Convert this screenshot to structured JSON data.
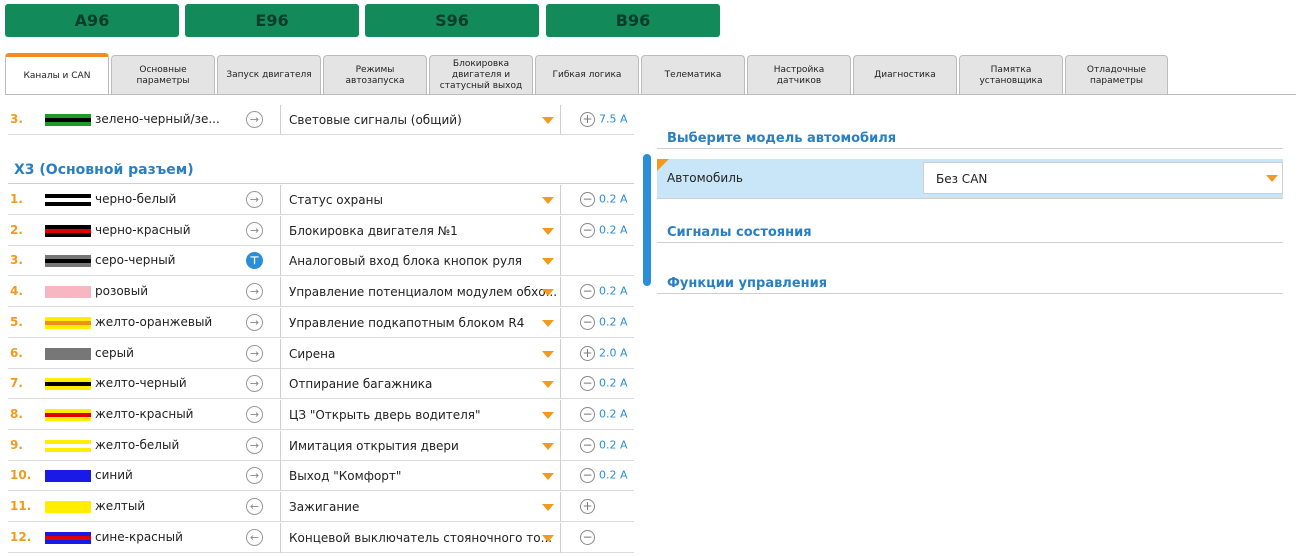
{
  "model_buttons": [
    "A96",
    "E96",
    "S96",
    "B96"
  ],
  "tabs": [
    "Каналы и CAN",
    "Основные параметры",
    "Запуск двигателя",
    "Режимы автозапуска",
    "Блокировка двигателя и статусный выход",
    "Гибкая логика",
    "Телематика",
    "Настройка датчиков",
    "Диагностика",
    "Памятка установщика",
    "Отладочные параметры"
  ],
  "top_row": {
    "num": "3.",
    "wire": "зелено-черный/зе...",
    "func": "Световые сигналы (общий)",
    "current": "7.5 A",
    "cur_icon": "plus",
    "colors": [
      "#1e9a28",
      "#000000"
    ]
  },
  "section": {
    "title": "Х3 (Основной разъем)"
  },
  "rows": [
    {
      "num": "1.",
      "wire": "черно-белый",
      "func": "Статус охраны",
      "current": "0.2 A",
      "cur_icon": "minus",
      "colors": [
        "#000000",
        "#ffffff"
      ]
    },
    {
      "num": "2.",
      "wire": "черно-красный",
      "func": "Блокировка двигателя №1",
      "current": "0.2 A",
      "cur_icon": "minus",
      "colors": [
        "#000000",
        "#e00000"
      ]
    },
    {
      "num": "3.",
      "wire": "серо-черный",
      "func": "Аналоговый вход блока кнопок руля",
      "current": "",
      "cur_icon": "",
      "colors": [
        "#777777",
        "#000000"
      ],
      "special": true
    },
    {
      "num": "4.",
      "wire": "розовый",
      "func": "Управление потенциалом модулем обхо...",
      "current": "0.2 A",
      "cur_icon": "minus",
      "colors": [
        "#f7b6c2",
        "#f7b6c2"
      ]
    },
    {
      "num": "5.",
      "wire": "желто-оранжевый",
      "func": "Управление подкапотным блоком R4",
      "current": "0.2 A",
      "cur_icon": "minus",
      "colors": [
        "#ffee00",
        "#f28c1b"
      ]
    },
    {
      "num": "6.",
      "wire": "серый",
      "func": "Сирена",
      "current": "2.0 A",
      "cur_icon": "plus",
      "colors": [
        "#777777",
        "#777777"
      ]
    },
    {
      "num": "7.",
      "wire": "желто-черный",
      "func": "Отпирание багажника",
      "current": "0.2 A",
      "cur_icon": "minus",
      "colors": [
        "#ffee00",
        "#000000"
      ]
    },
    {
      "num": "8.",
      "wire": "желто-красный",
      "func": "ЦЗ \"Открыть дверь водителя\"",
      "current": "0.2 A",
      "cur_icon": "minus",
      "colors": [
        "#ffee00",
        "#e00000"
      ]
    },
    {
      "num": "9.",
      "wire": "желто-белый",
      "func": "Имитация открытия двери",
      "current": "0.2 A",
      "cur_icon": "minus",
      "colors": [
        "#ffee00",
        "#ffffff"
      ]
    },
    {
      "num": "10.",
      "wire": "синий",
      "func": "Выход \"Комфорт\"",
      "current": "0.2 A",
      "cur_icon": "minus",
      "colors": [
        "#1a1ae6",
        "#1a1ae6"
      ]
    },
    {
      "num": "11.",
      "wire": "желтый",
      "func": "Зажигание",
      "current": "",
      "cur_icon": "plus",
      "colors": [
        "#ffee00",
        "#ffee00"
      ],
      "input": true
    },
    {
      "num": "12.",
      "wire": "сине-красный",
      "func": "Концевой выключатель стояночного то...",
      "current": "",
      "cur_icon": "minus",
      "colors": [
        "#1a1ae6",
        "#e00000"
      ],
      "input": true
    }
  ],
  "right": {
    "car_model_header": "Выберите модель автомобиля",
    "car_label": "Автомобиль",
    "car_value": "Без CAN",
    "status_header": "Сигналы состояния",
    "control_header": "Функции управления"
  }
}
